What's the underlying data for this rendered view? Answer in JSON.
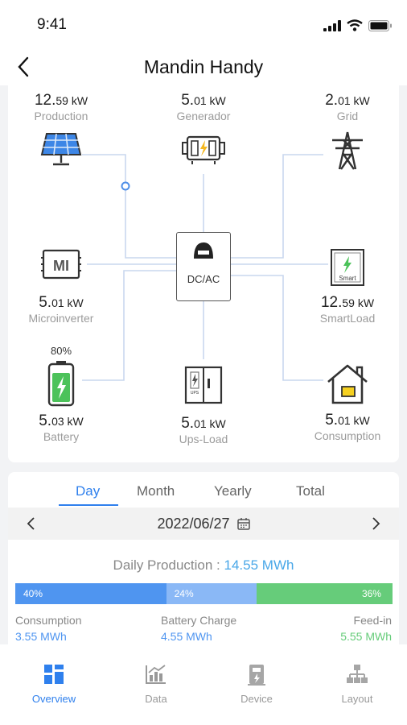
{
  "status_bar": {
    "time": "9:41"
  },
  "header": {
    "title": "Mandin Handy"
  },
  "flow": {
    "production": {
      "value": "12.",
      "decimal": "59",
      "unit": "kW",
      "label": "Production"
    },
    "generator": {
      "value": "5.",
      "decimal": "01",
      "unit": "kW",
      "label": "Generador"
    },
    "grid": {
      "value": "2.",
      "decimal": "01",
      "unit": "kW",
      "label": "Grid"
    },
    "microinverter": {
      "value": "5.",
      "decimal": "01",
      "unit": "kW",
      "label": "Microinverter",
      "icon_text": "MI"
    },
    "smartload": {
      "value": "12.",
      "decimal": "59",
      "unit": "kW",
      "label": "SmartLoad",
      "icon_text": "Smart"
    },
    "battery": {
      "soc": "80%",
      "value": "5.",
      "decimal": "03",
      "unit": "kW",
      "label": "Battery"
    },
    "ups_load": {
      "value": "5.",
      "decimal": "01",
      "unit": "kW",
      "label": "Ups-Load",
      "icon_text": "UPS"
    },
    "consumption": {
      "value": "5.",
      "decimal": "01",
      "unit": "kW",
      "label": "Consumption"
    },
    "inverter": {
      "label": "DC/AC"
    }
  },
  "production": {
    "tabs": [
      {
        "label": "Day",
        "active": true
      },
      {
        "label": "Month",
        "active": false
      },
      {
        "label": "Yearly",
        "active": false
      },
      {
        "label": "Total",
        "active": false
      }
    ],
    "date": "2022/06/27",
    "daily_label": "Daily Production :",
    "daily_value": "14.55 MWh",
    "bar": [
      {
        "label": "40%",
        "fraction": 0.4,
        "color": "#4f95f0"
      },
      {
        "label": "24%",
        "fraction": 0.24,
        "color": "#8ab8f6"
      },
      {
        "label": "36%",
        "fraction": 0.36,
        "color": "#66cc7a"
      }
    ],
    "legend": [
      {
        "label": "Consumption",
        "value": "3.55 MWh",
        "color": "#4f95f0"
      },
      {
        "label": "Battery Charge",
        "value": "4.55 MWh",
        "color": "#4f95f0"
      },
      {
        "label": "Feed-in",
        "value": "5.55 MWh",
        "color": "#66cc7a"
      }
    ]
  },
  "bottom_nav": [
    {
      "label": "Overview",
      "icon": "overview-icon",
      "active": true
    },
    {
      "label": "Data",
      "icon": "data-icon",
      "active": false
    },
    {
      "label": "Device",
      "icon": "device-icon",
      "active": false
    },
    {
      "label": "Layout",
      "icon": "layout-icon",
      "active": false
    }
  ],
  "colors": {
    "accent": "#2f80ed",
    "flow_line": "#c9d7ee",
    "battery_green": "#4cc25a",
    "house_yellow": "#f5d020"
  }
}
